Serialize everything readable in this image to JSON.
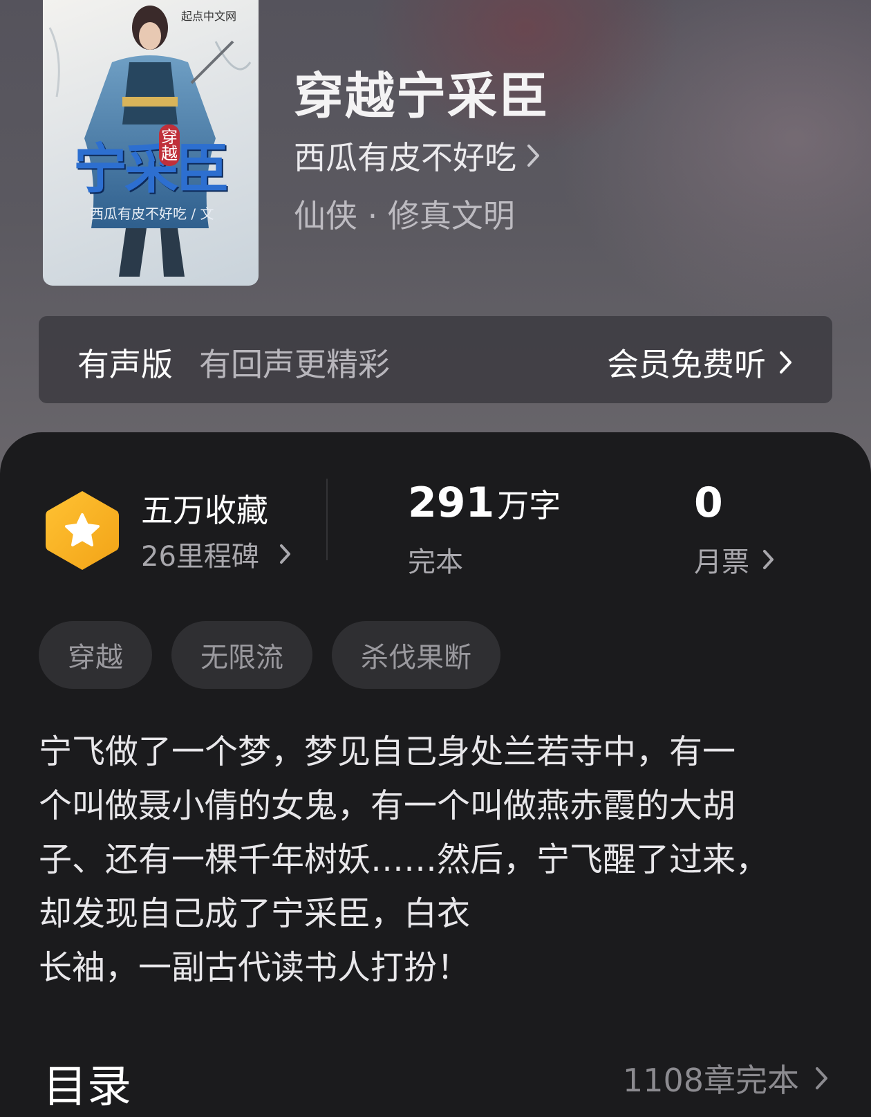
{
  "book": {
    "title": "穿越宁采臣",
    "author": "西瓜有皮不好吃",
    "genre": "仙侠 · 修真文明",
    "cover": {
      "title_art": "宁采臣",
      "badge": "穿越",
      "byline": "西瓜有皮不好吃 / 文",
      "publisher": "起点中文网"
    }
  },
  "audio": {
    "label": "有声版",
    "subtitle": "有回声更精彩",
    "action": "会员免费听"
  },
  "stats": {
    "favorites": "五万收藏",
    "milestones": "26里程碑",
    "words_number": "291",
    "words_unit": "万字",
    "status": "完本",
    "monthly_votes": "0",
    "monthly_votes_label": "月票"
  },
  "tags": [
    "穿越",
    "无限流",
    "杀伐果断"
  ],
  "synopsis": "宁飞做了一个梦，梦见自己身处兰若寺中，有一\n个叫做聂小倩的女鬼，有一个叫做燕赤霞的大胡\n子、还有一棵千年树妖……然后，宁飞醒了过来，\n却发现自己成了宁采臣，白衣\n长袖，一副古代读书人打扮！",
  "toc": {
    "title": "目录",
    "summary": "1108章完本"
  },
  "colors": {
    "badge_gold": "#f6b01f",
    "panel_bg": "#1b1b1d",
    "tag_bg": "#2f2f32"
  }
}
